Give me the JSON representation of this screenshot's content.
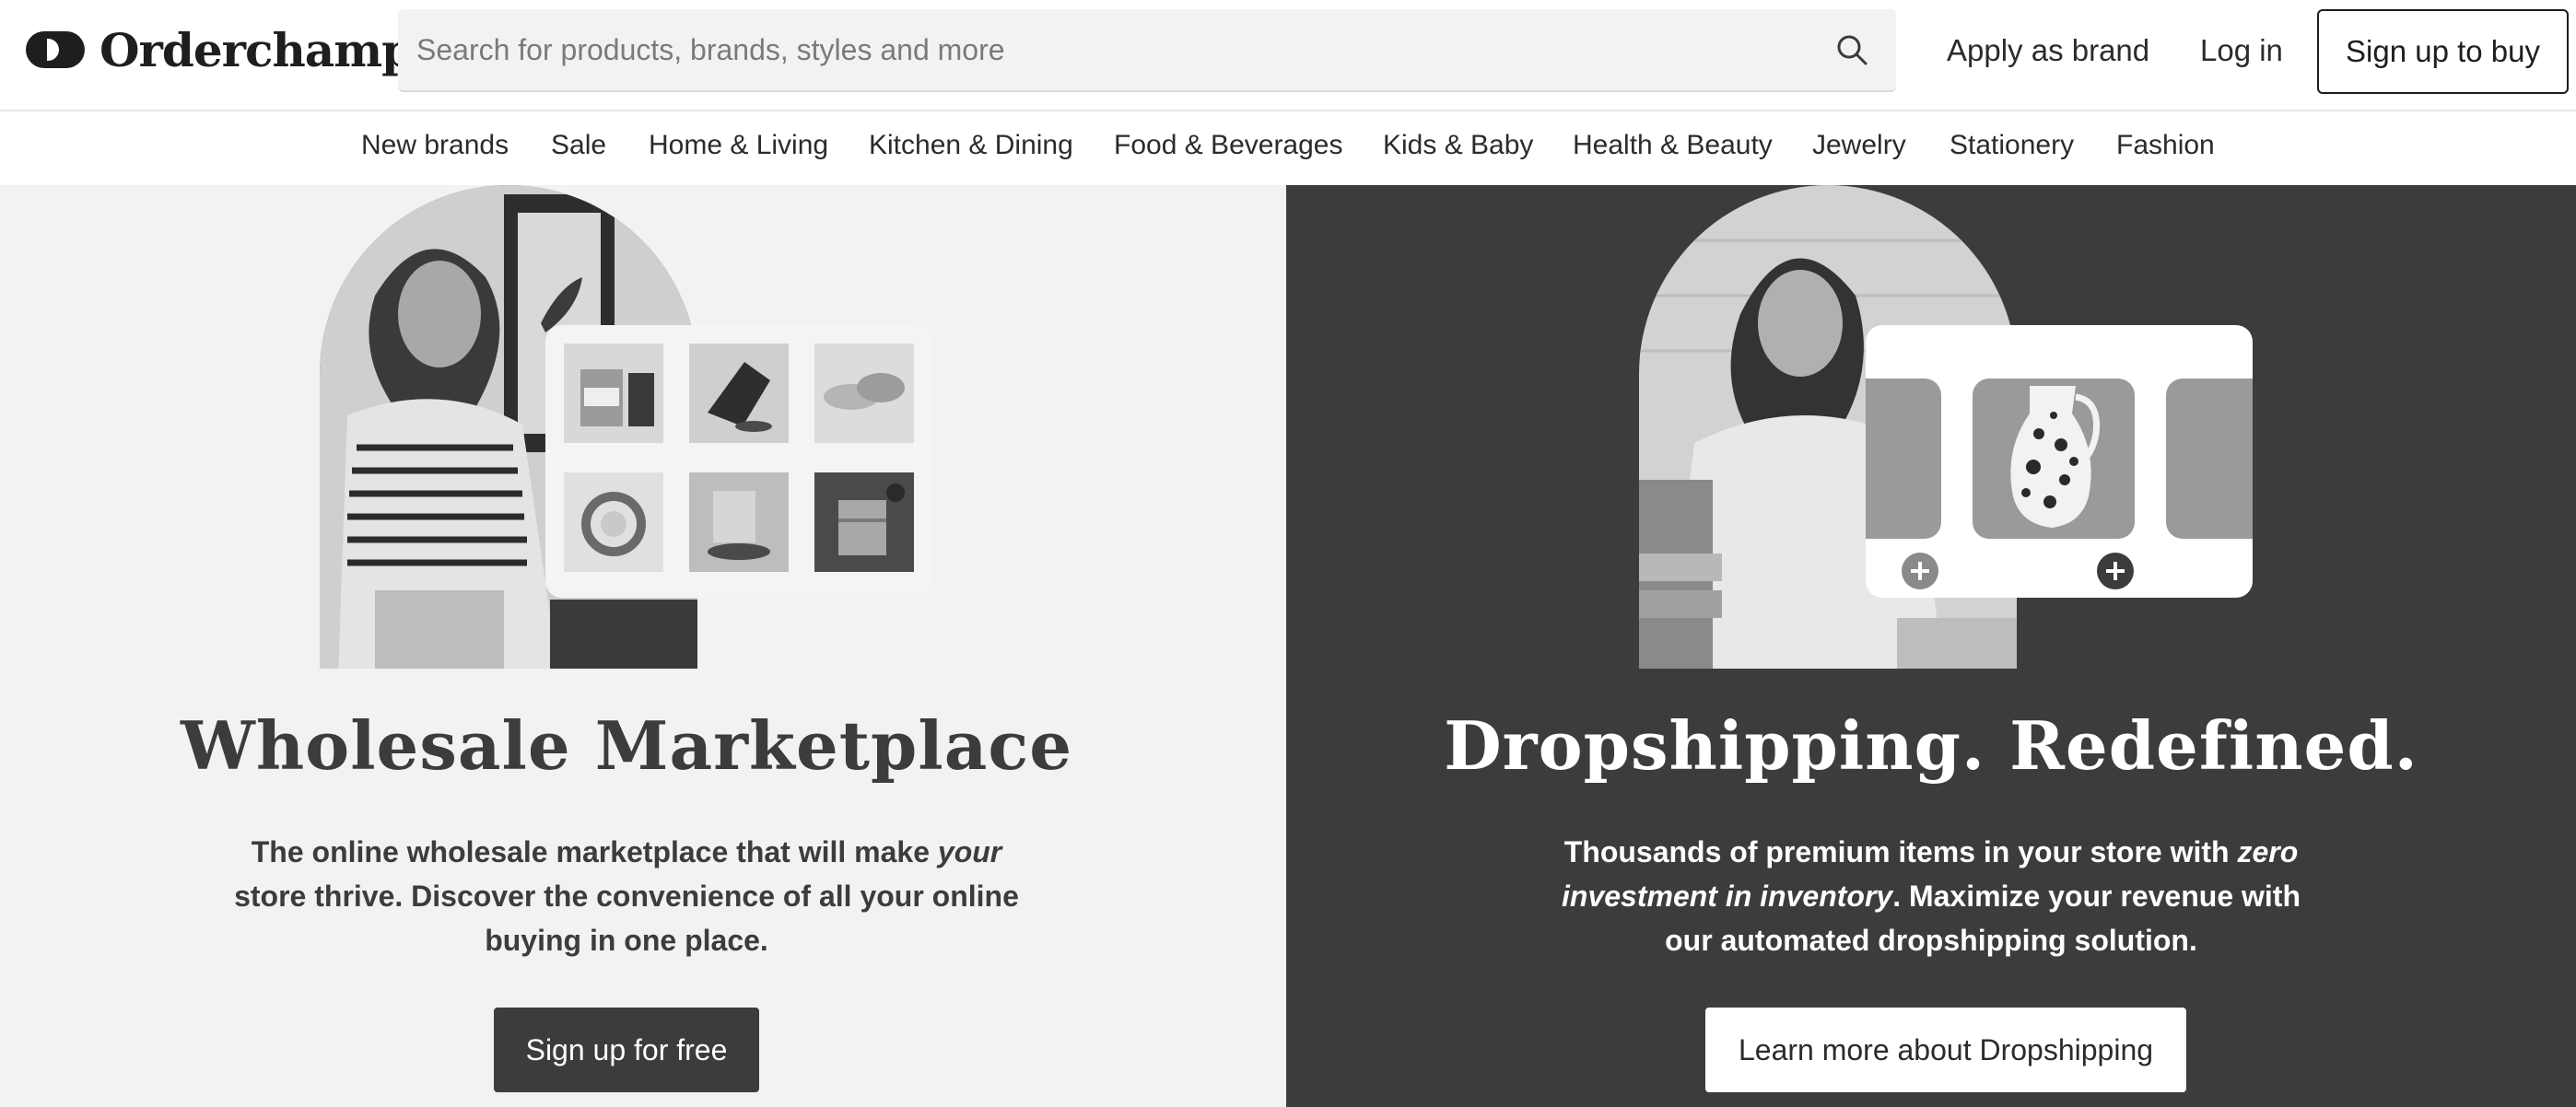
{
  "header": {
    "logo_text": "Orderchamp",
    "search": {
      "placeholder": "Search for products, brands, styles and more",
      "icon": "search-icon"
    },
    "links": {
      "apply_brand": "Apply as brand",
      "login": "Log in"
    },
    "signup_button": "Sign up to buy"
  },
  "categories": [
    "New brands",
    "Sale",
    "Home & Living",
    "Kitchen & Dining",
    "Food & Beverages",
    "Kids & Baby",
    "Health & Beauty",
    "Jewelry",
    "Stationery",
    "Fashion"
  ],
  "wholesale": {
    "title": "Wholesale Marketplace",
    "text_part1": "The online wholesale marketplace that will make ",
    "text_em": "your",
    "text_part2": " store thrive. Discover the convenience of all your online buying in one place.",
    "button": "Sign up for free"
  },
  "dropshipping": {
    "title": "Dropshipping. Redefined.",
    "text_part1": "Thousands of premium items in your store with ",
    "text_em": "zero investment in inventory",
    "text_part2": ". Maximize your revenue with our automated dropshipping solution.",
    "button": "Learn more about Dropshipping"
  },
  "colors": {
    "dark_panel": "#3c3c3c",
    "light_panel": "#f2f2f2",
    "button_dark": "#3c3c3c",
    "text": "#2b2b2b"
  }
}
